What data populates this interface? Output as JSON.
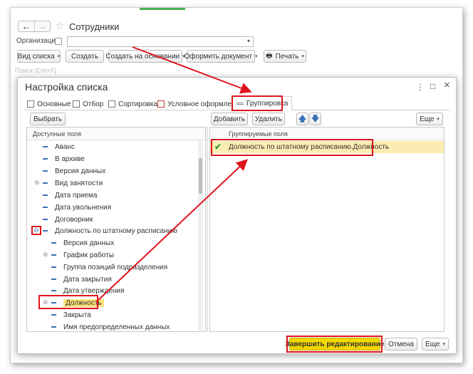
{
  "main_window": {
    "title": "Сотрудники",
    "org_label": "Организация:",
    "toolbar": {
      "view_list": "Вид списка",
      "create": "Создать",
      "create_based": "Создать на основании",
      "make_doc": "Оформить документ",
      "print": "Печать"
    },
    "search_placeholder": "Поиск (Ctrl+F)"
  },
  "dialog": {
    "title": "Настройка списка",
    "menu_glyph": "⋮",
    "max_glyph": "□",
    "close_glyph": "×",
    "tabs": [
      {
        "label": "Основные"
      },
      {
        "label": "Отбор"
      },
      {
        "label": "Сортировка"
      },
      {
        "label": "Условное оформление"
      },
      {
        "label": "Группировка"
      }
    ],
    "left": {
      "select_button": "Выбрать",
      "header": "Доступные поля",
      "items": [
        {
          "label": "Аванс"
        },
        {
          "label": "В архиве"
        },
        {
          "label": "Версия данных"
        },
        {
          "label": "Вид занятости"
        },
        {
          "label": "Дата приема"
        },
        {
          "label": "Дата увольнения"
        },
        {
          "label": "Договорник"
        },
        {
          "label": "Должность по штатному расписанию"
        },
        {
          "label": "Версия данных"
        },
        {
          "label": "График работы"
        },
        {
          "label": "Группа позиций подразделения"
        },
        {
          "label": "Дата закрытия"
        },
        {
          "label": "Дата утверждения"
        },
        {
          "label": "Должность"
        },
        {
          "label": "Закрыта"
        },
        {
          "label": "Имя предопределенных данных"
        }
      ]
    },
    "right": {
      "add_button": "Добавить",
      "delete_button": "Удалить",
      "more_button": "Еще",
      "header": "Группируемые поля",
      "row_label": "Должность по штатному расписанию.Должность",
      "row_checked": true
    },
    "footer": {
      "finish_button": "Завершить редактирование",
      "cancel_button": "Отмена",
      "more_button": "Еще"
    }
  },
  "colors": {
    "annotation_red": "#e0141e",
    "highlight_yellow": "#fbe27a",
    "selected_row": "#fbedb2",
    "icon_blue": "#3d6fb6"
  }
}
